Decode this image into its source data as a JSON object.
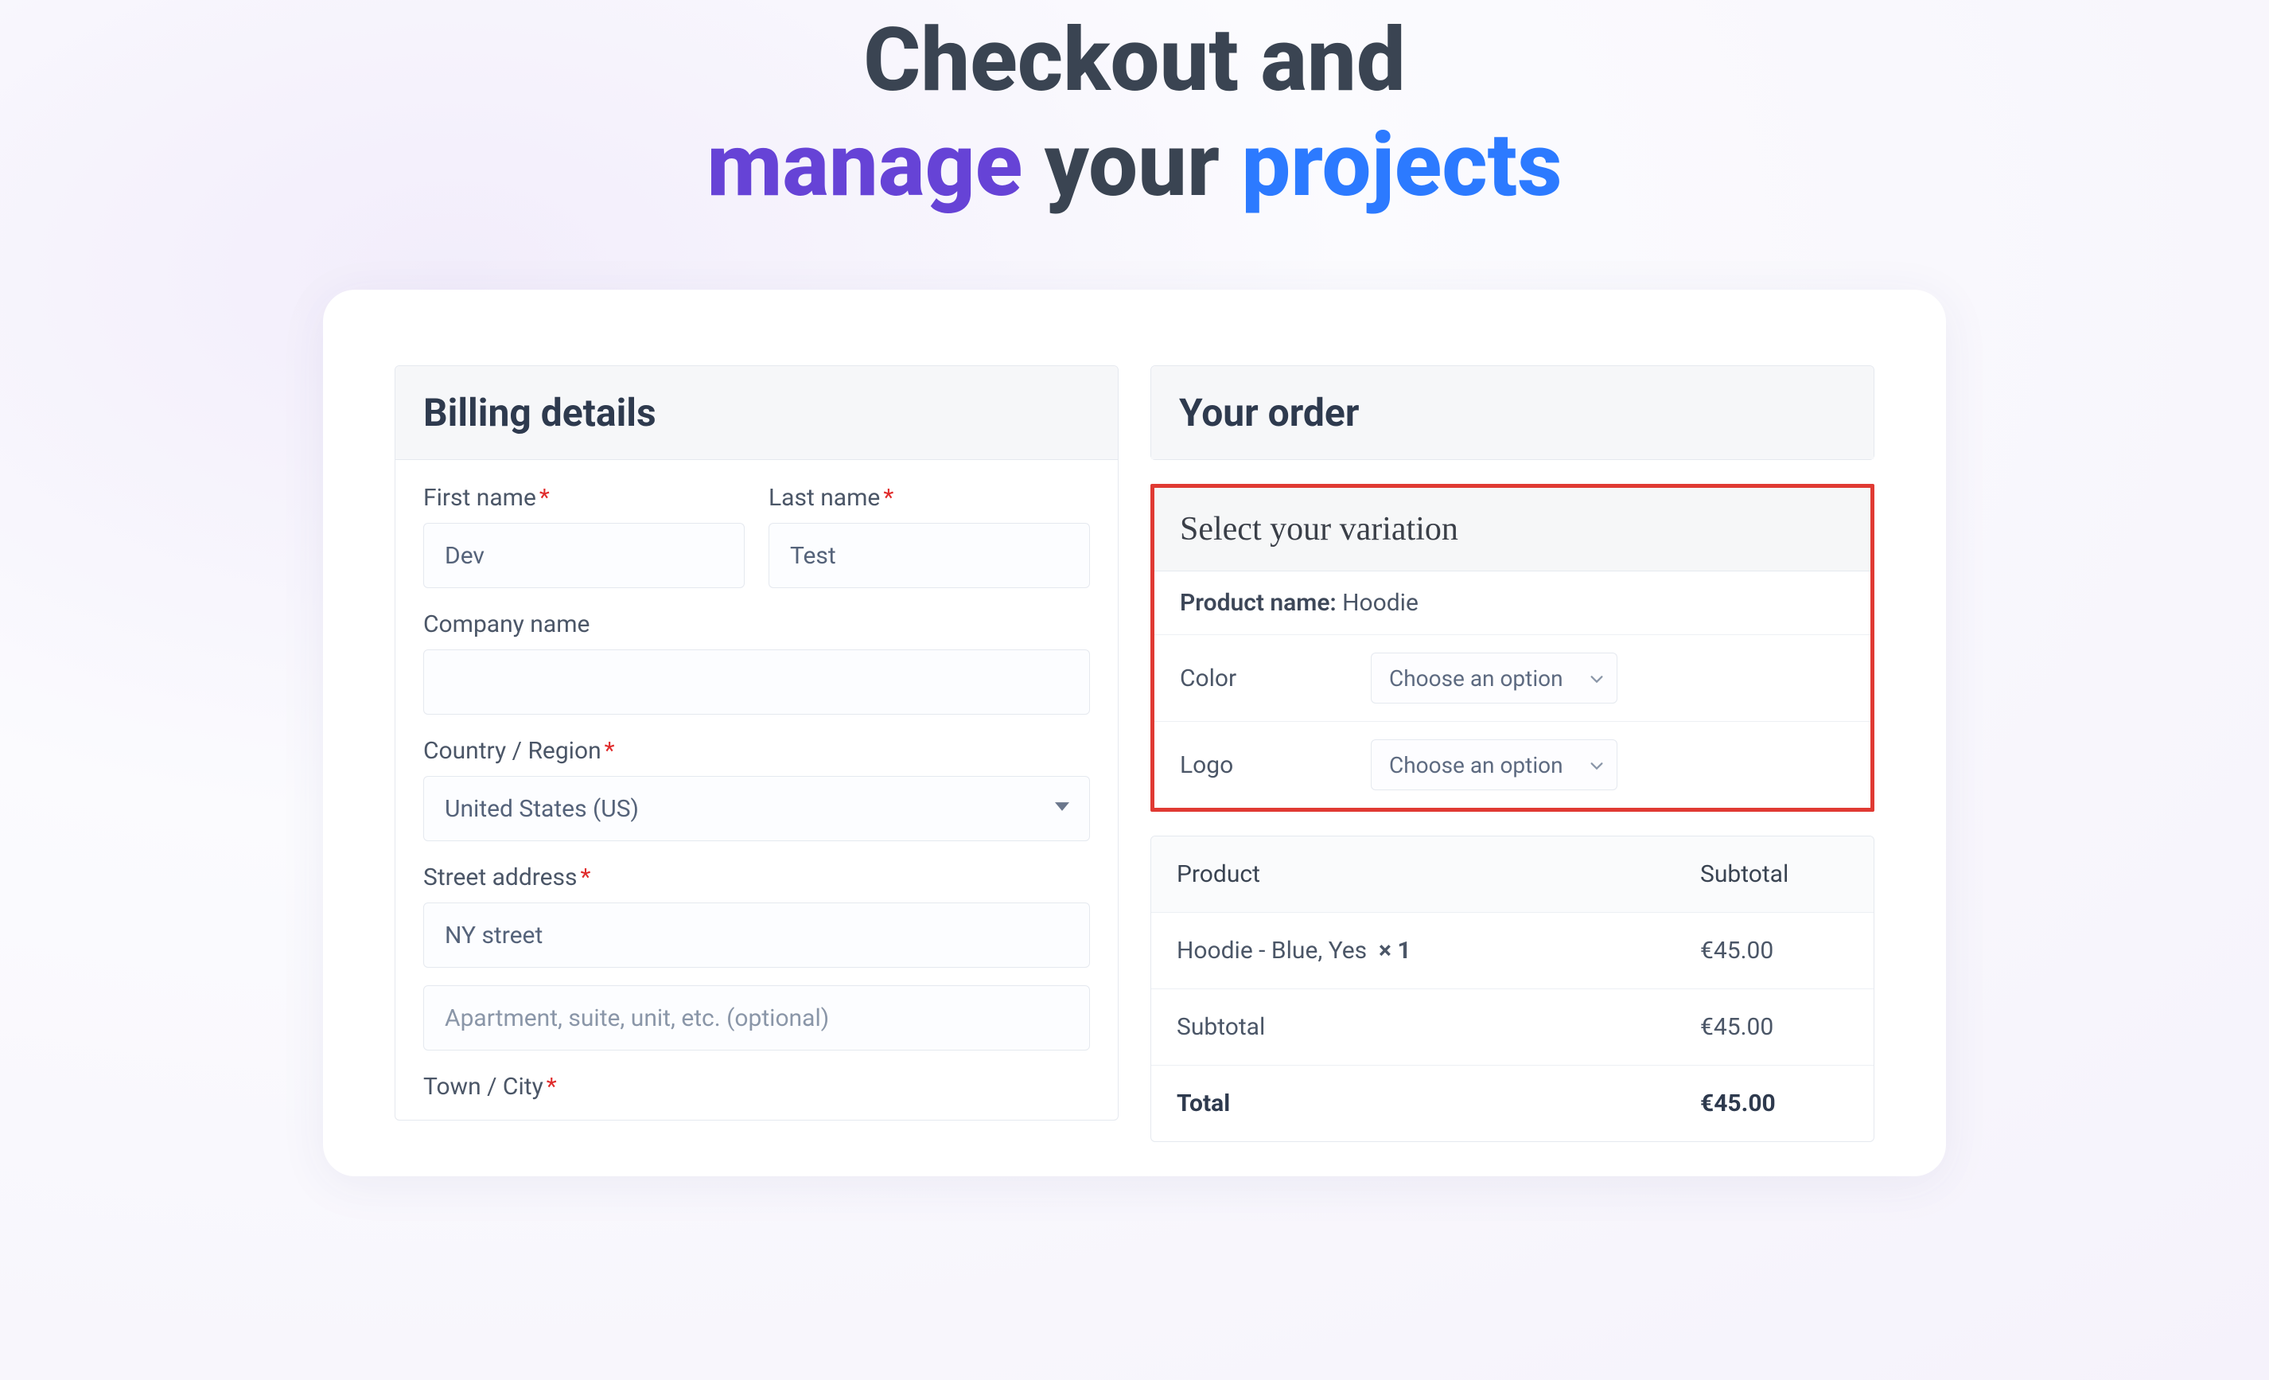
{
  "title": {
    "line1": "Checkout and",
    "word_manage": "manage",
    "mid": "your",
    "word_projects": "projects"
  },
  "billing": {
    "header": "Billing details",
    "first_name": {
      "label": "First name",
      "required": true,
      "value": "Dev"
    },
    "last_name": {
      "label": "Last name",
      "required": true,
      "value": "Test"
    },
    "company": {
      "label": "Company name",
      "required": false,
      "value": ""
    },
    "country": {
      "label": "Country / Region",
      "required": true,
      "value": "United States (US)"
    },
    "street": {
      "label": "Street address",
      "required": true,
      "line1_value": "NY street",
      "line2_placeholder": "Apartment, suite, unit, etc. (optional)"
    },
    "city": {
      "label": "Town / City",
      "required": true,
      "value": ""
    }
  },
  "order": {
    "header": "Your order",
    "variation": {
      "title": "Select your variation",
      "product_label": "Product name:",
      "product_name": "Hoodie",
      "rows": [
        {
          "label": "Color",
          "placeholder": "Choose an option"
        },
        {
          "label": "Logo",
          "placeholder": "Choose an option"
        }
      ]
    },
    "table": {
      "head_product": "Product",
      "head_subtotal": "Subtotal",
      "line_item": {
        "name": "Hoodie - Blue, Yes",
        "qty": "× 1",
        "subtotal": "€45.00"
      },
      "subtotal": {
        "label": "Subtotal",
        "value": "€45.00"
      },
      "total": {
        "label": "Total",
        "value": "€45.00"
      }
    }
  },
  "asterisk": "*"
}
